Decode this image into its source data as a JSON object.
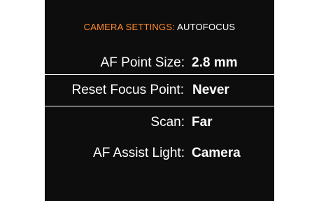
{
  "header": {
    "category": "CAMERA SETTINGS:",
    "page": "AUTOFOCUS"
  },
  "settings": [
    {
      "label": "AF Point Size:",
      "value": "2.8 mm",
      "selected": false
    },
    {
      "label": "Reset Focus Point:",
      "value": "Never",
      "selected": true
    },
    {
      "label": "Scan:",
      "value": "Far",
      "selected": false
    },
    {
      "label": "AF Assist Light:",
      "value": "Camera",
      "selected": false
    }
  ],
  "colors": {
    "background": "#0d0d0d",
    "accent": "#ff8a2a",
    "text": "#ffffff"
  }
}
